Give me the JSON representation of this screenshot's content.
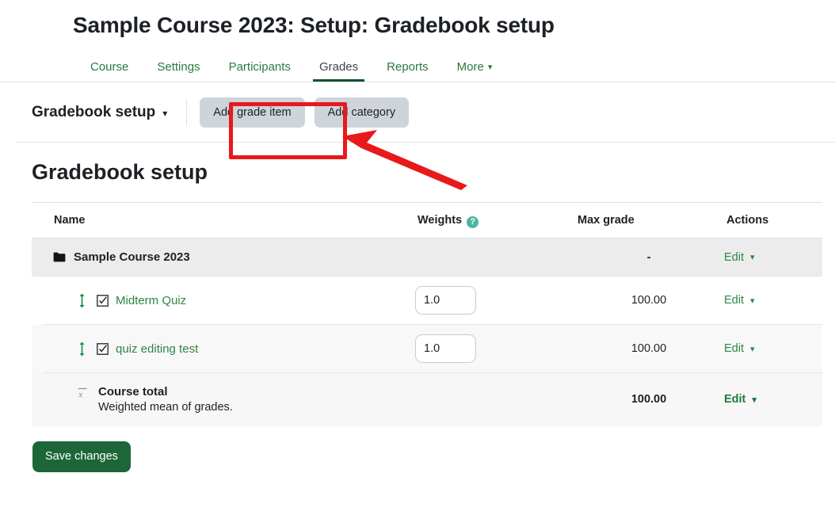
{
  "header": {
    "title": "Sample Course 2023: Setup: Gradebook setup",
    "tabs": [
      {
        "label": "Course",
        "active": false
      },
      {
        "label": "Settings",
        "active": false
      },
      {
        "label": "Participants",
        "active": false
      },
      {
        "label": "Grades",
        "active": true
      },
      {
        "label": "Reports",
        "active": false
      },
      {
        "label": "More",
        "active": false,
        "caret": true
      }
    ]
  },
  "actionbar": {
    "report_selector_label": "Gradebook setup",
    "add_grade_item_label": "Add grade item",
    "add_category_label": "Add category"
  },
  "annotation": {
    "highlight_color": "#e8191a",
    "target": "Add grade item"
  },
  "main": {
    "title": "Gradebook setup",
    "columns": {
      "name": "Name",
      "weights": "Weights",
      "weights_help": "?",
      "max_grade": "Max grade",
      "actions": "Actions"
    },
    "rows": [
      {
        "type": "category",
        "icon": "folder-icon",
        "name": "Sample Course 2023",
        "weight": null,
        "max_grade": "-",
        "action": "Edit",
        "action_bold": false
      },
      {
        "type": "item",
        "icon": "quiz-icon",
        "move_icon": "move-vertical-icon",
        "name": "Midterm Quiz",
        "weight": "1.0",
        "max_grade": "100.00",
        "action": "Edit",
        "action_bold": false
      },
      {
        "type": "item",
        "icon": "quiz-icon",
        "move_icon": "move-vertical-icon",
        "name": "quiz editing test",
        "weight": "1.0",
        "max_grade": "100.00",
        "action": "Edit",
        "action_bold": false
      },
      {
        "type": "total",
        "icon": "mean-xbar-icon",
        "name": "Course total",
        "description": "Weighted mean of grades.",
        "weight": null,
        "max_grade": "100.00",
        "action": "Edit",
        "action_bold": true
      }
    ]
  },
  "footer": {
    "save_label": "Save changes"
  },
  "colors": {
    "link_green": "#2e8545",
    "primary_green": "#1d6638",
    "active_tab_underline": "#17542c",
    "help_teal": "#4eb3a5",
    "annotation_red": "#e8191a",
    "button_gray": "#ced4da"
  }
}
